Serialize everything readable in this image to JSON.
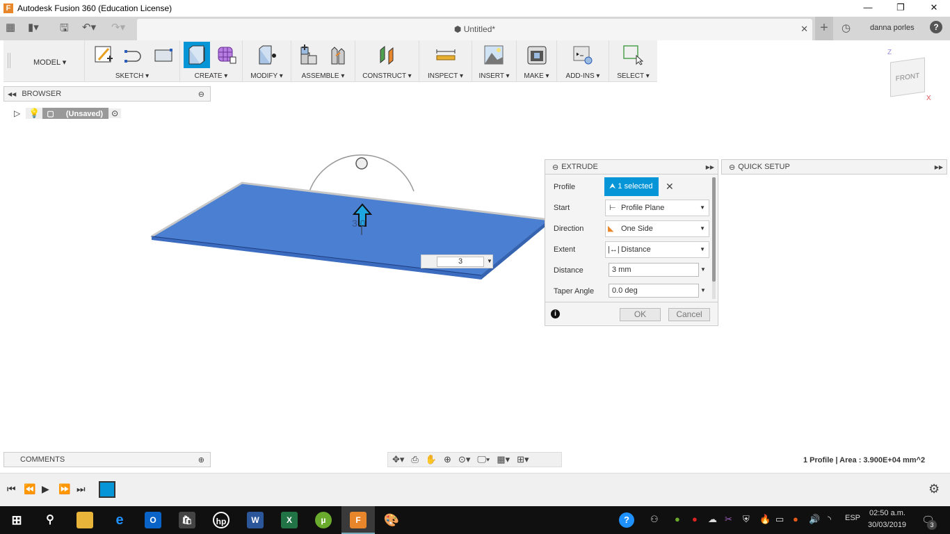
{
  "window": {
    "title": "Autodesk Fusion 360 (Education License)",
    "app_icon": "F"
  },
  "tabbar": {
    "doc_title": "Untitled*",
    "user": "danna porles",
    "help": "?"
  },
  "toolbar": {
    "workspace": "MODEL",
    "groups": [
      "SKETCH",
      "CREATE",
      "MODIFY",
      "ASSEMBLE",
      "CONSTRUCT",
      "INSPECT",
      "INSERT",
      "MAKE",
      "ADD-INS",
      "SELECT"
    ]
  },
  "browser": {
    "title": "BROWSER",
    "root": "(Unsaved)"
  },
  "viewcube": {
    "face": "FRONT",
    "axis_z": "Z",
    "axis_x": "X"
  },
  "canvas": {
    "manipulator_value": "3",
    "arrow_label": "3.0"
  },
  "extrude": {
    "title": "EXTRUDE",
    "fields": [
      {
        "label": "Profile",
        "value": "1 selected"
      },
      {
        "label": "Start",
        "value": "Profile Plane"
      },
      {
        "label": "Direction",
        "value": "One Side"
      },
      {
        "label": "Extent",
        "value": "Distance"
      },
      {
        "label": "Distance",
        "value": "3 mm"
      },
      {
        "label": "Taper Angle",
        "value": "0.0 deg"
      }
    ],
    "ok": "OK",
    "cancel": "Cancel",
    "accent": "#0696d7"
  },
  "quick_setup": {
    "title": "QUICK SETUP"
  },
  "comments": {
    "title": "COMMENTS"
  },
  "status": {
    "text": "1 Profile | Area : 3.900E+04 mm^2"
  },
  "taskbar": {
    "lang": "ESP",
    "time": "02:50 a.m.",
    "date": "30/03/2019",
    "notifications": "3"
  }
}
